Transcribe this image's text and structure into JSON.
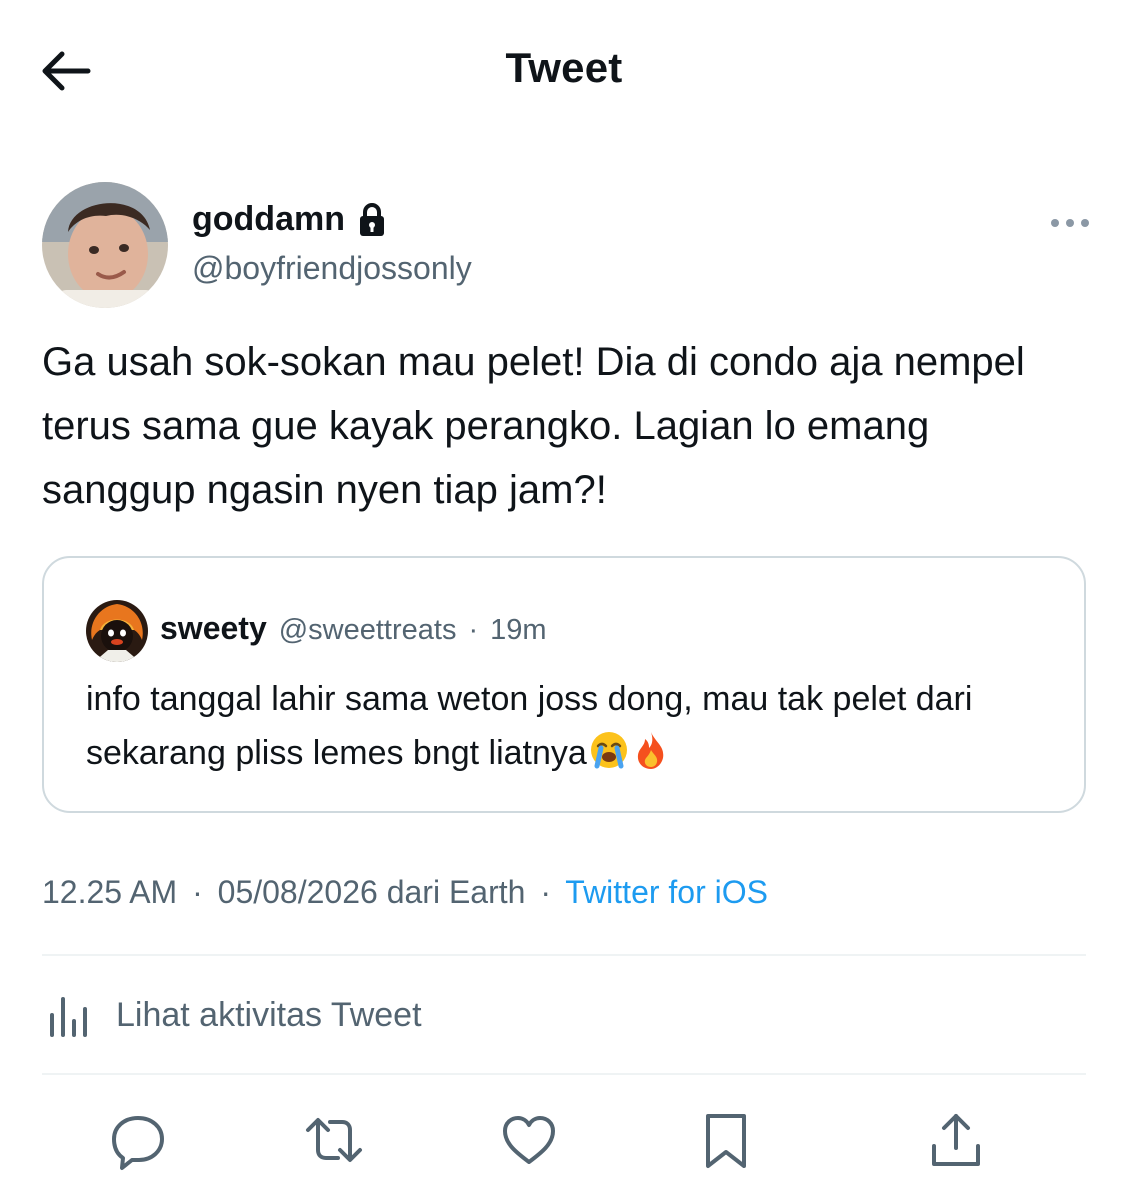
{
  "header": {
    "title": "Tweet",
    "back_icon": "arrow-left-icon"
  },
  "author": {
    "display_name": "goddamn",
    "handle": "@boyfriendjossonly",
    "protected_icon": "lock-icon",
    "more_icon": "more-horizontal-icon"
  },
  "tweet": {
    "text": "Ga usah sok-sokan mau pelet! Dia di condo aja nempel terus sama gue kayak perangko. Lagian lo emang sanggup ngasin nyen tiap jam?!"
  },
  "quote": {
    "name": "sweety",
    "handle": "@sweettreats",
    "separator": "·",
    "time": "19m",
    "text": "info tanggal lahir sama weton joss dong, mau tak pelet dari sekarang pliss lemes bngt liatnya",
    "emojis": [
      "crying-face-emoji",
      "fire-emoji"
    ]
  },
  "meta": {
    "time": "12.25 AM",
    "sep1": "·",
    "date_location": "05/08/2026 dari Earth",
    "sep2": "·",
    "source": "Twitter for iOS"
  },
  "activity": {
    "label": "Lihat aktivitas Tweet",
    "icon": "bar-chart-icon"
  },
  "actions": [
    {
      "name": "reply",
      "icon": "reply-icon"
    },
    {
      "name": "retweet",
      "icon": "retweet-icon"
    },
    {
      "name": "like",
      "icon": "heart-icon"
    },
    {
      "name": "bookmark",
      "icon": "bookmark-icon"
    },
    {
      "name": "share",
      "icon": "share-icon"
    }
  ],
  "colors": {
    "text_primary": "#0f1419",
    "text_secondary": "#536471",
    "accent": "#1d9bf0",
    "border": "#cfd9de",
    "divider": "#eff3f4"
  }
}
